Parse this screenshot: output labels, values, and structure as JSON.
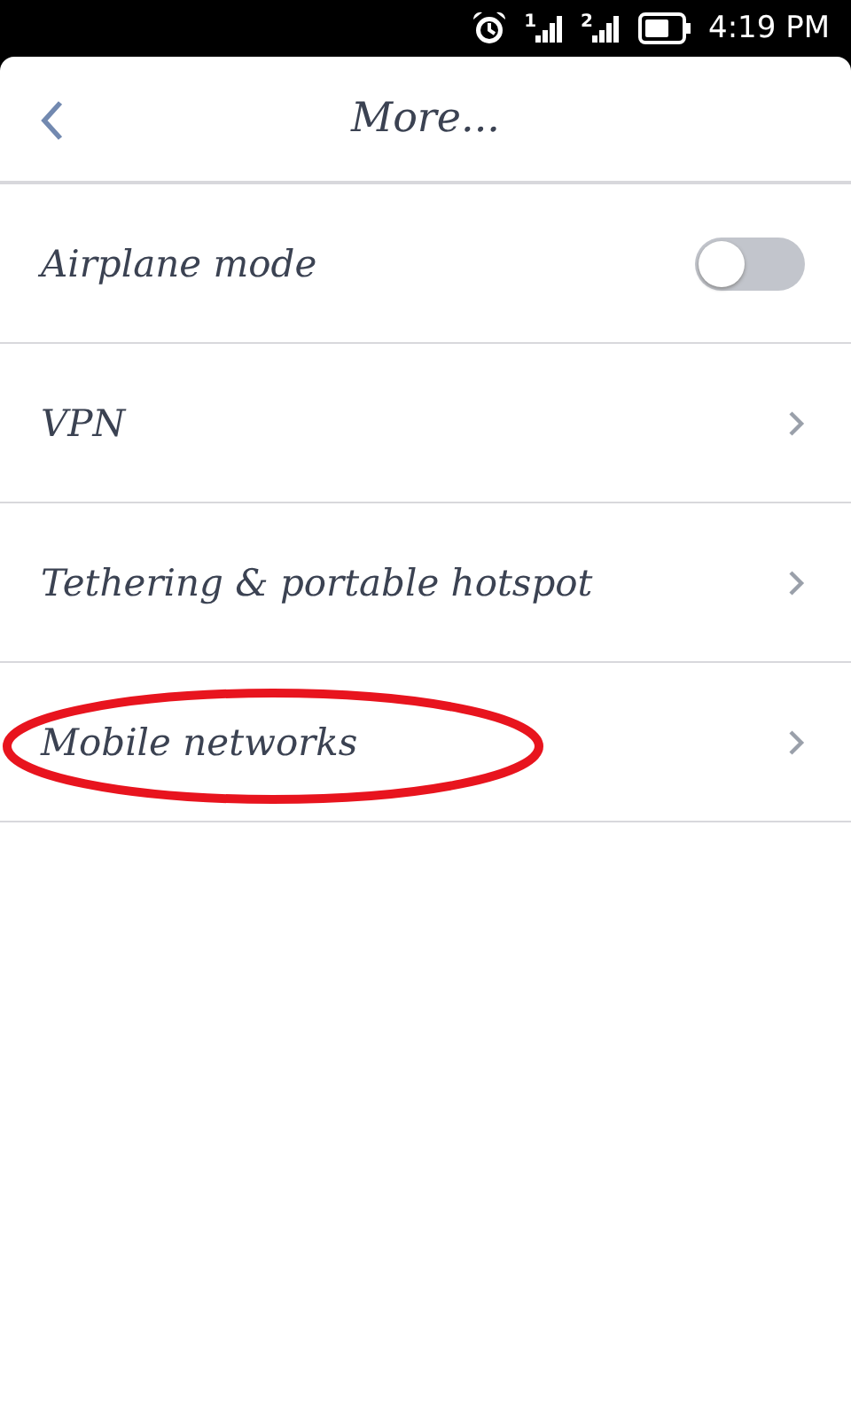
{
  "status_bar": {
    "sims": [
      "1",
      "2"
    ],
    "time": "4:19 PM"
  },
  "header": {
    "title": "More..."
  },
  "items": [
    {
      "kind": "toggle",
      "label": "Airplane mode",
      "on": false,
      "circled": false
    },
    {
      "kind": "link",
      "label": "VPN",
      "circled": false
    },
    {
      "kind": "link",
      "label": "Tethering & portable hotspot",
      "circled": false
    },
    {
      "kind": "link",
      "label": "Mobile networks",
      "circled": true
    }
  ]
}
